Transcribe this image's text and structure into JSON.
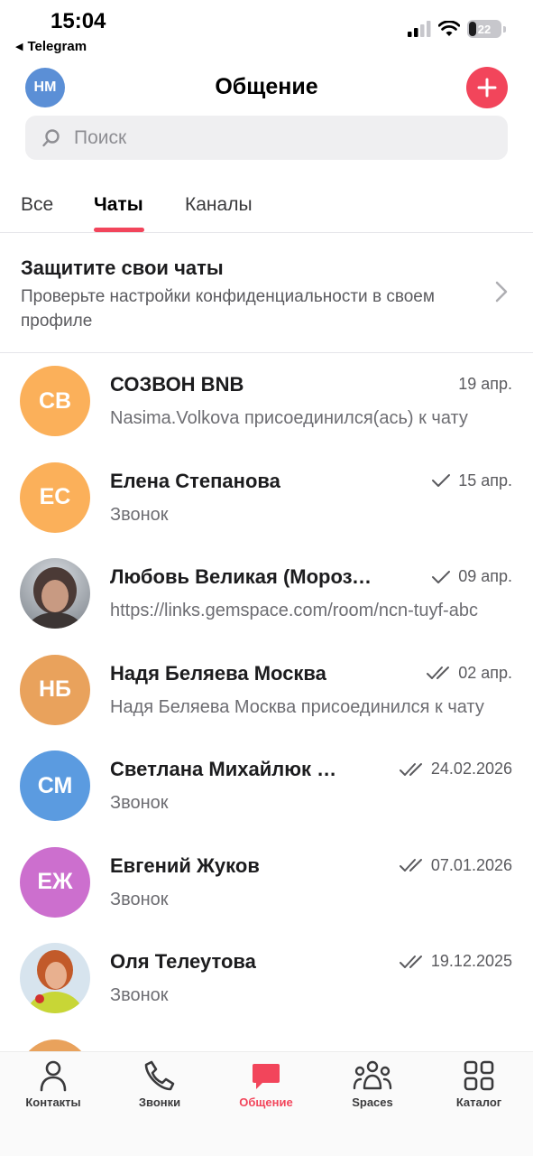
{
  "status_bar": {
    "time": "15:04",
    "back_app": "Telegram",
    "battery": "22"
  },
  "header": {
    "avatar_initials": "НМ",
    "title": "Общение"
  },
  "search": {
    "placeholder": "Поиск"
  },
  "tabs": [
    {
      "label": "Все",
      "active": false
    },
    {
      "label": "Чаты",
      "active": true
    },
    {
      "label": "Каналы",
      "active": false
    }
  ],
  "privacy_banner": {
    "title": "Защитите свои чаты",
    "text": "Проверьте настройки конфиденциальности в своем профиле"
  },
  "chats": [
    {
      "initials": "СВ",
      "color": "#fbb05a",
      "name": "СОЗВОН BNB",
      "date": "19 апр.",
      "ticks": 0,
      "preview": "Nasima.Volkova присоединился(ась) к чату"
    },
    {
      "initials": "ЕС",
      "color": "#fbb05a",
      "name": "Елена Степанова",
      "date": "15 апр.",
      "ticks": 1,
      "preview": "Звонок"
    },
    {
      "initials": "",
      "color": "#8a7f78",
      "name": "Любовь Великая (Морозова)",
      "date": "09 апр.",
      "ticks": 1,
      "preview": "https://links.gemspace.com/room/ncn-tuyf-abc"
    },
    {
      "initials": "НБ",
      "color": "#e9a25c",
      "name": "Надя Беляева Москва",
      "date": "02 апр.",
      "ticks": 2,
      "preview": "Надя Беляева Москва присоединился к чату"
    },
    {
      "initials": "СМ",
      "color": "#5b9be0",
      "name": "Светлана Михайлюк Сергеевна",
      "date": "24.02.2026",
      "ticks": 2,
      "preview": "Звонок"
    },
    {
      "initials": "ЕЖ",
      "color": "#cc6fce",
      "name": "Евгений Жуков",
      "date": "07.01.2026",
      "ticks": 2,
      "preview": "Звонок"
    },
    {
      "initials": "",
      "color": "#c9d94a",
      "name": "Оля Телеутова",
      "date": "19.12.2025",
      "ticks": 2,
      "preview": "Звонок"
    },
    {
      "initials": "",
      "color": "#e9a25c",
      "name": "",
      "date": "",
      "ticks": 0,
      "preview": ""
    }
  ],
  "bottom_nav": [
    {
      "label": "Контакты",
      "icon": "person-icon",
      "active": false
    },
    {
      "label": "Звонки",
      "icon": "phone-icon",
      "active": false
    },
    {
      "label": "Общение",
      "icon": "chat-bubble-icon",
      "active": true
    },
    {
      "label": "Spaces",
      "icon": "people-group-icon",
      "active": false
    },
    {
      "label": "Каталог",
      "icon": "grid-icon",
      "active": false
    }
  ],
  "colors": {
    "accent": "#f2455b"
  }
}
